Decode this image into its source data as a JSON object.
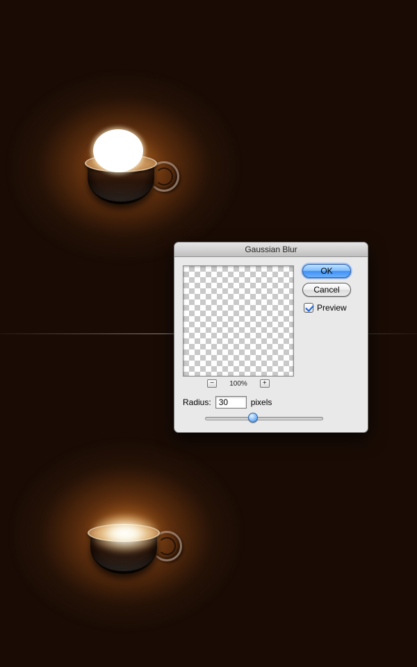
{
  "dialog": {
    "title": "Gaussian Blur",
    "ok_label": "OK",
    "cancel_label": "Cancel",
    "preview_label": "Preview",
    "zoom_out_glyph": "−",
    "zoom_pct": "100%",
    "zoom_in_glyph": "+",
    "radius_label": "Radius:",
    "radius_value": "30",
    "radius_unit": "pixels"
  }
}
